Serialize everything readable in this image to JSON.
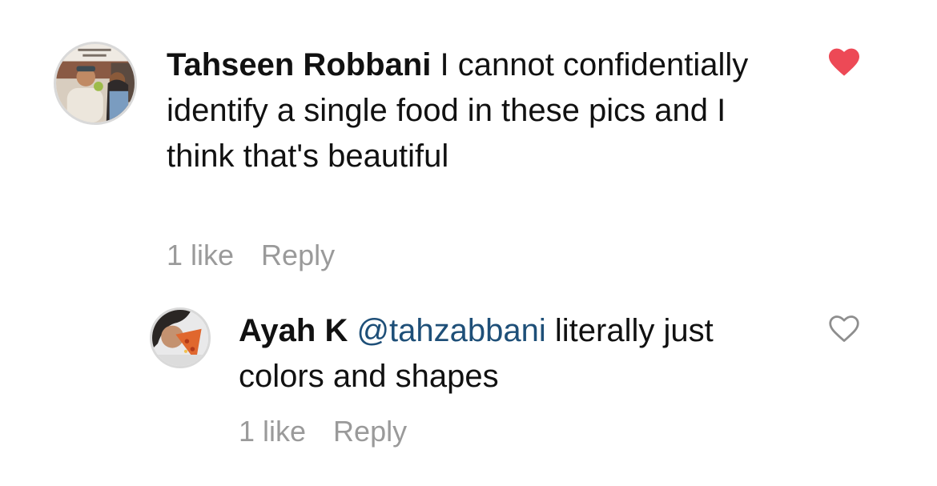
{
  "comments": [
    {
      "username": "Tahseen Robbani",
      "text": "I cannot confidentially identify a single food in these pics and I think that's beautiful",
      "likes": "1 like",
      "reply_label": "Reply",
      "liked": true,
      "like_color": "#ed4956",
      "avatar_icon": "user-photo-avatar"
    }
  ],
  "replies": [
    {
      "username": "Ayah K",
      "mention": "@tahzabbani",
      "text": "literally just colors and shapes",
      "likes": "1 like",
      "reply_label": "Reply",
      "liked": false,
      "mention_color": "#1e4f78",
      "avatar_icon": "user-photo-avatar"
    }
  ]
}
